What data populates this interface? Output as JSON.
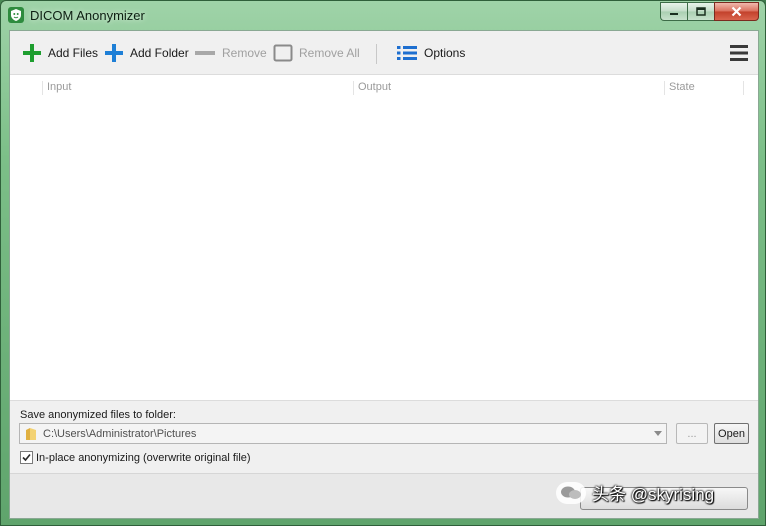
{
  "window": {
    "title": "DICOM Anonymizer"
  },
  "toolbar": {
    "add_files": "Add Files",
    "add_folder": "Add Folder",
    "remove": "Remove",
    "remove_all": "Remove All",
    "options": "Options"
  },
  "table": {
    "columns": [
      "Input",
      "Output",
      "State"
    ]
  },
  "output": {
    "save_label": "Save anonymized files to folder:",
    "folder_path": "C:\\Users\\Administrator\\Pictures",
    "browse_label": "...",
    "open_label": "Open",
    "inplace_label": "In-place anonymizing (overwrite original file)",
    "inplace_checked": true
  },
  "watermark": {
    "text": "头条 @skyrising"
  },
  "colors": {
    "add_icon_green": "#1e9e2f",
    "add_folder_blue": "#1e7fd6",
    "options_blue": "#1e6fd0",
    "disabled_gray": "#a0a0a0"
  },
  "icons": {
    "app": "shield-icon",
    "add_files": "plus-icon",
    "add_folder": "plus-icon",
    "remove": "minus-icon",
    "remove_all": "square-icon",
    "options": "list-icon",
    "menu": "hamburger-icon",
    "folder": "folder-icon"
  }
}
